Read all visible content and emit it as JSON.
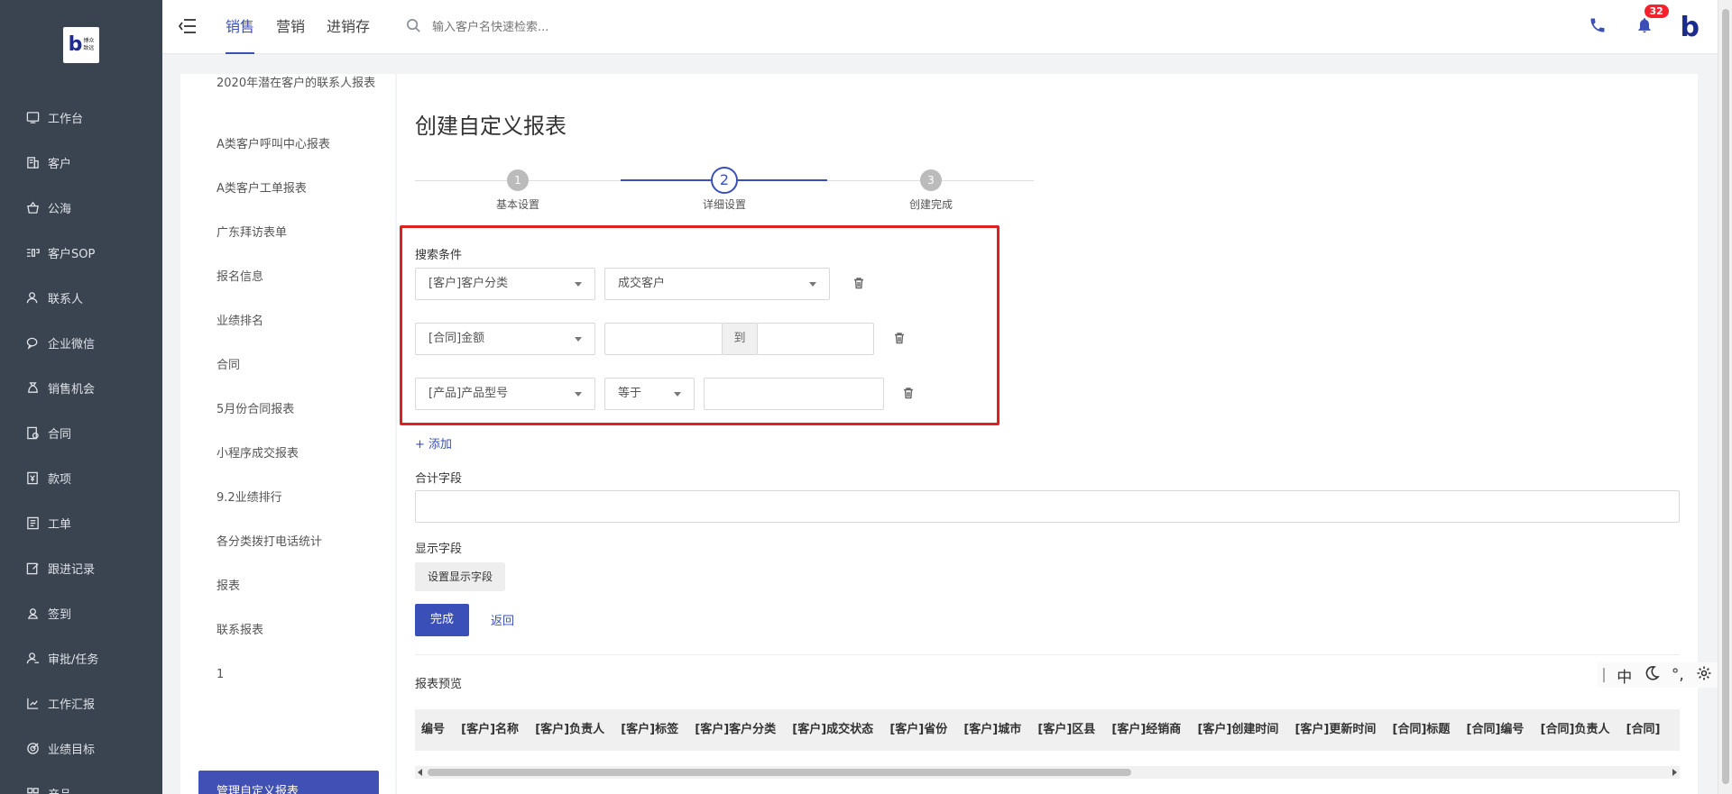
{
  "nav": {
    "logo_text": "博众\n致远",
    "items": [
      {
        "label": "工作台",
        "icon": "desktop-icon"
      },
      {
        "label": "客户",
        "icon": "building-icon"
      },
      {
        "label": "公海",
        "icon": "basket-icon"
      },
      {
        "label": "客户SOP",
        "icon": "sop-icon"
      },
      {
        "label": "联系人",
        "icon": "contact-icon"
      },
      {
        "label": "企业微信",
        "icon": "wechat-icon"
      },
      {
        "label": "销售机会",
        "icon": "moneybag-icon"
      },
      {
        "label": "合同",
        "icon": "contract-icon"
      },
      {
        "label": "款项",
        "icon": "payment-icon"
      },
      {
        "label": "工单",
        "icon": "ticket-icon"
      },
      {
        "label": "跟进记录",
        "icon": "edit-icon"
      },
      {
        "label": "签到",
        "icon": "location-icon"
      },
      {
        "label": "审批/任务",
        "icon": "user-task-icon"
      },
      {
        "label": "工作汇报",
        "icon": "report-icon"
      },
      {
        "label": "业绩目标",
        "icon": "target-icon"
      },
      {
        "label": "产品",
        "icon": "grid-icon"
      }
    ]
  },
  "topbar": {
    "tabs": [
      {
        "label": "销售",
        "active": true
      },
      {
        "label": "营销",
        "active": false
      },
      {
        "label": "进销存",
        "active": false
      }
    ],
    "search_placeholder": "输入客户名快速检索...",
    "notification_count": "32",
    "brand_letter": "b"
  },
  "reports": {
    "items": [
      "2020年潜在客户的联系人报表",
      "A类客户呼叫中心报表",
      "A类客户工单报表",
      "广东拜访表单",
      "报名信息",
      "业绩排名",
      "合同",
      "5月份合同报表",
      "小程序成交报表",
      "9.2业绩排行",
      "各分类拨打电话统计",
      "报表",
      "联系报表",
      "1"
    ],
    "active": "管理自定义报表"
  },
  "main": {
    "title": "创建自定义报表",
    "steps": [
      {
        "num": "1",
        "label": "基本设置"
      },
      {
        "num": "2",
        "label": "详细设置"
      },
      {
        "num": "3",
        "label": "创建完成"
      }
    ],
    "current_step": 2,
    "search_label": "搜索条件",
    "conditions": {
      "row1": {
        "field": "[客户]客户分类",
        "value": "成交客户"
      },
      "row2": {
        "field": "[合同]金额",
        "to": "到"
      },
      "row3": {
        "field": "[产品]产品型号",
        "operator": "等于"
      }
    },
    "add_label": "+ 添加",
    "sum_label": "合计字段",
    "display_label": "显示字段",
    "set_display_btn": "设置显示字段",
    "done_btn": "完成",
    "back_link": "返回",
    "preview_label": "报表预览",
    "columns": [
      "编号",
      "[客户]名称",
      "[客户]负责人",
      "[客户]标签",
      "[客户]客户分类",
      "[客户]成交状态",
      "[客户]省份",
      "[客户]城市",
      "[客户]区县",
      "[客户]经销商",
      "[客户]创建时间",
      "[客户]更新时间",
      "[合同]标题",
      "[合同]编号",
      "[合同]负责人",
      "[合同]"
    ]
  },
  "ime": {
    "lang": "中",
    "punct": "°,"
  },
  "colors": {
    "accent": "#3b4fb8",
    "nav_bg": "#3a4350",
    "highlight": "#e02020"
  }
}
